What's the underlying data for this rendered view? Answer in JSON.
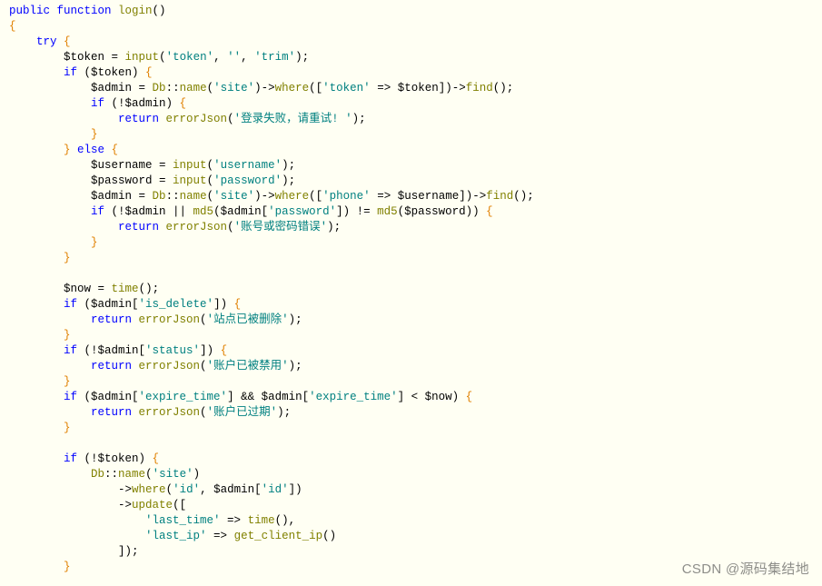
{
  "watermark": "CSDN @源码集结地",
  "lines": [
    {
      "indent": 0,
      "segs": [
        {
          "t": "public ",
          "c": "kw"
        },
        {
          "t": "function ",
          "c": "kw"
        },
        {
          "t": "login",
          "c": "fn"
        },
        {
          "t": "()",
          "c": "op"
        }
      ]
    },
    {
      "indent": 0,
      "segs": [
        {
          "t": "{",
          "c": "brace"
        }
      ]
    },
    {
      "indent": 1,
      "segs": [
        {
          "t": "try ",
          "c": "kw"
        },
        {
          "t": "{",
          "c": "brace"
        }
      ]
    },
    {
      "indent": 2,
      "segs": [
        {
          "t": "$token ",
          "c": "var"
        },
        {
          "t": "= ",
          "c": "op"
        },
        {
          "t": "input",
          "c": "ident"
        },
        {
          "t": "(",
          "c": "op"
        },
        {
          "t": "'token'",
          "c": "str"
        },
        {
          "t": ", ",
          "c": "op"
        },
        {
          "t": "''",
          "c": "str"
        },
        {
          "t": ", ",
          "c": "op"
        },
        {
          "t": "'trim'",
          "c": "str"
        },
        {
          "t": ");",
          "c": "op"
        }
      ]
    },
    {
      "indent": 2,
      "segs": [
        {
          "t": "if ",
          "c": "kw"
        },
        {
          "t": "($token) ",
          "c": "var"
        },
        {
          "t": "{",
          "c": "brace"
        }
      ]
    },
    {
      "indent": 3,
      "segs": [
        {
          "t": "$admin ",
          "c": "var"
        },
        {
          "t": "= ",
          "c": "op"
        },
        {
          "t": "Db",
          "c": "ident"
        },
        {
          "t": "::",
          "c": "op"
        },
        {
          "t": "name",
          "c": "ident"
        },
        {
          "t": "(",
          "c": "op"
        },
        {
          "t": "'site'",
          "c": "str"
        },
        {
          "t": ")->",
          "c": "op"
        },
        {
          "t": "where",
          "c": "ident"
        },
        {
          "t": "([",
          "c": "op"
        },
        {
          "t": "'token'",
          "c": "str"
        },
        {
          "t": " => $token])->",
          "c": "op"
        },
        {
          "t": "find",
          "c": "ident"
        },
        {
          "t": "();",
          "c": "op"
        }
      ]
    },
    {
      "indent": 3,
      "segs": [
        {
          "t": "if ",
          "c": "kw"
        },
        {
          "t": "(!$admin) ",
          "c": "var"
        },
        {
          "t": "{",
          "c": "brace"
        }
      ]
    },
    {
      "indent": 4,
      "segs": [
        {
          "t": "return ",
          "c": "kw"
        },
        {
          "t": "errorJson",
          "c": "ident"
        },
        {
          "t": "(",
          "c": "op"
        },
        {
          "t": "'登录失败，请重试! '",
          "c": "str"
        },
        {
          "t": ");",
          "c": "op"
        }
      ]
    },
    {
      "indent": 3,
      "segs": [
        {
          "t": "}",
          "c": "brace"
        }
      ]
    },
    {
      "indent": 2,
      "segs": [
        {
          "t": "} ",
          "c": "brace"
        },
        {
          "t": "else ",
          "c": "kw"
        },
        {
          "t": "{",
          "c": "brace"
        }
      ]
    },
    {
      "indent": 3,
      "segs": [
        {
          "t": "$username ",
          "c": "var"
        },
        {
          "t": "= ",
          "c": "op"
        },
        {
          "t": "input",
          "c": "ident"
        },
        {
          "t": "(",
          "c": "op"
        },
        {
          "t": "'username'",
          "c": "str"
        },
        {
          "t": ");",
          "c": "op"
        }
      ]
    },
    {
      "indent": 3,
      "segs": [
        {
          "t": "$password ",
          "c": "var"
        },
        {
          "t": "= ",
          "c": "op"
        },
        {
          "t": "input",
          "c": "ident"
        },
        {
          "t": "(",
          "c": "op"
        },
        {
          "t": "'password'",
          "c": "str"
        },
        {
          "t": ");",
          "c": "op"
        }
      ]
    },
    {
      "indent": 3,
      "segs": [
        {
          "t": "$admin ",
          "c": "var"
        },
        {
          "t": "= ",
          "c": "op"
        },
        {
          "t": "Db",
          "c": "ident"
        },
        {
          "t": "::",
          "c": "op"
        },
        {
          "t": "name",
          "c": "ident"
        },
        {
          "t": "(",
          "c": "op"
        },
        {
          "t": "'site'",
          "c": "str"
        },
        {
          "t": ")->",
          "c": "op"
        },
        {
          "t": "where",
          "c": "ident"
        },
        {
          "t": "([",
          "c": "op"
        },
        {
          "t": "'phone'",
          "c": "str"
        },
        {
          "t": " => $username])->",
          "c": "op"
        },
        {
          "t": "find",
          "c": "ident"
        },
        {
          "t": "();",
          "c": "op"
        }
      ]
    },
    {
      "indent": 3,
      "segs": [
        {
          "t": "if ",
          "c": "kw"
        },
        {
          "t": "(!$admin || ",
          "c": "var"
        },
        {
          "t": "md5",
          "c": "ident"
        },
        {
          "t": "($admin[",
          "c": "var"
        },
        {
          "t": "'password'",
          "c": "str"
        },
        {
          "t": "]) != ",
          "c": "var"
        },
        {
          "t": "md5",
          "c": "ident"
        },
        {
          "t": "($password)) ",
          "c": "var"
        },
        {
          "t": "{",
          "c": "brace"
        }
      ]
    },
    {
      "indent": 4,
      "segs": [
        {
          "t": "return ",
          "c": "kw"
        },
        {
          "t": "errorJson",
          "c": "ident"
        },
        {
          "t": "(",
          "c": "op"
        },
        {
          "t": "'账号或密码错误'",
          "c": "str"
        },
        {
          "t": ");",
          "c": "op"
        }
      ]
    },
    {
      "indent": 3,
      "segs": [
        {
          "t": "}",
          "c": "brace"
        }
      ]
    },
    {
      "indent": 2,
      "segs": [
        {
          "t": "}",
          "c": "brace"
        }
      ]
    },
    {
      "indent": 0,
      "segs": [
        {
          "t": " ",
          "c": "op"
        }
      ]
    },
    {
      "indent": 2,
      "segs": [
        {
          "t": "$now ",
          "c": "var"
        },
        {
          "t": "= ",
          "c": "op"
        },
        {
          "t": "time",
          "c": "ident"
        },
        {
          "t": "();",
          "c": "op"
        }
      ]
    },
    {
      "indent": 2,
      "segs": [
        {
          "t": "if ",
          "c": "kw"
        },
        {
          "t": "($admin[",
          "c": "var"
        },
        {
          "t": "'is_delete'",
          "c": "str"
        },
        {
          "t": "]) ",
          "c": "var"
        },
        {
          "t": "{",
          "c": "brace"
        }
      ]
    },
    {
      "indent": 3,
      "segs": [
        {
          "t": "return ",
          "c": "kw"
        },
        {
          "t": "errorJson",
          "c": "ident"
        },
        {
          "t": "(",
          "c": "op"
        },
        {
          "t": "'站点已被删除'",
          "c": "str"
        },
        {
          "t": ");",
          "c": "op"
        }
      ]
    },
    {
      "indent": 2,
      "segs": [
        {
          "t": "}",
          "c": "brace"
        }
      ]
    },
    {
      "indent": 2,
      "segs": [
        {
          "t": "if ",
          "c": "kw"
        },
        {
          "t": "(!$admin[",
          "c": "var"
        },
        {
          "t": "'status'",
          "c": "str"
        },
        {
          "t": "]) ",
          "c": "var"
        },
        {
          "t": "{",
          "c": "brace"
        }
      ]
    },
    {
      "indent": 3,
      "segs": [
        {
          "t": "return ",
          "c": "kw"
        },
        {
          "t": "errorJson",
          "c": "ident"
        },
        {
          "t": "(",
          "c": "op"
        },
        {
          "t": "'账户已被禁用'",
          "c": "str"
        },
        {
          "t": ");",
          "c": "op"
        }
      ]
    },
    {
      "indent": 2,
      "segs": [
        {
          "t": "}",
          "c": "brace"
        }
      ]
    },
    {
      "indent": 2,
      "segs": [
        {
          "t": "if ",
          "c": "kw"
        },
        {
          "t": "($admin[",
          "c": "var"
        },
        {
          "t": "'expire_time'",
          "c": "str"
        },
        {
          "t": "] && $admin[",
          "c": "var"
        },
        {
          "t": "'expire_time'",
          "c": "str"
        },
        {
          "t": "] < $now) ",
          "c": "var"
        },
        {
          "t": "{",
          "c": "brace"
        }
      ]
    },
    {
      "indent": 3,
      "segs": [
        {
          "t": "return ",
          "c": "kw"
        },
        {
          "t": "errorJson",
          "c": "ident"
        },
        {
          "t": "(",
          "c": "op"
        },
        {
          "t": "'账户已过期'",
          "c": "str"
        },
        {
          "t": ");",
          "c": "op"
        }
      ]
    },
    {
      "indent": 2,
      "segs": [
        {
          "t": "}",
          "c": "brace"
        }
      ]
    },
    {
      "indent": 0,
      "segs": [
        {
          "t": " ",
          "c": "op"
        }
      ]
    },
    {
      "indent": 2,
      "segs": [
        {
          "t": "if ",
          "c": "kw"
        },
        {
          "t": "(!$token) ",
          "c": "var"
        },
        {
          "t": "{",
          "c": "brace"
        }
      ]
    },
    {
      "indent": 3,
      "segs": [
        {
          "t": "Db",
          "c": "ident"
        },
        {
          "t": "::",
          "c": "op"
        },
        {
          "t": "name",
          "c": "ident"
        },
        {
          "t": "(",
          "c": "op"
        },
        {
          "t": "'site'",
          "c": "str"
        },
        {
          "t": ")",
          "c": "op"
        }
      ]
    },
    {
      "indent": 4,
      "segs": [
        {
          "t": "->",
          "c": "op"
        },
        {
          "t": "where",
          "c": "ident"
        },
        {
          "t": "(",
          "c": "op"
        },
        {
          "t": "'id'",
          "c": "str"
        },
        {
          "t": ", $admin[",
          "c": "var"
        },
        {
          "t": "'id'",
          "c": "str"
        },
        {
          "t": "])",
          "c": "op"
        }
      ]
    },
    {
      "indent": 4,
      "segs": [
        {
          "t": "->",
          "c": "op"
        },
        {
          "t": "update",
          "c": "ident"
        },
        {
          "t": "([",
          "c": "op"
        }
      ]
    },
    {
      "indent": 5,
      "segs": [
        {
          "t": "'last_time'",
          "c": "str"
        },
        {
          "t": " => ",
          "c": "op"
        },
        {
          "t": "time",
          "c": "ident"
        },
        {
          "t": "(),",
          "c": "op"
        }
      ]
    },
    {
      "indent": 5,
      "segs": [
        {
          "t": "'last_ip'",
          "c": "str"
        },
        {
          "t": " => ",
          "c": "op"
        },
        {
          "t": "get_client_ip",
          "c": "ident"
        },
        {
          "t": "()",
          "c": "op"
        }
      ]
    },
    {
      "indent": 4,
      "segs": [
        {
          "t": "]);",
          "c": "op"
        }
      ]
    },
    {
      "indent": 2,
      "segs": [
        {
          "t": "}",
          "c": "brace"
        }
      ]
    }
  ]
}
